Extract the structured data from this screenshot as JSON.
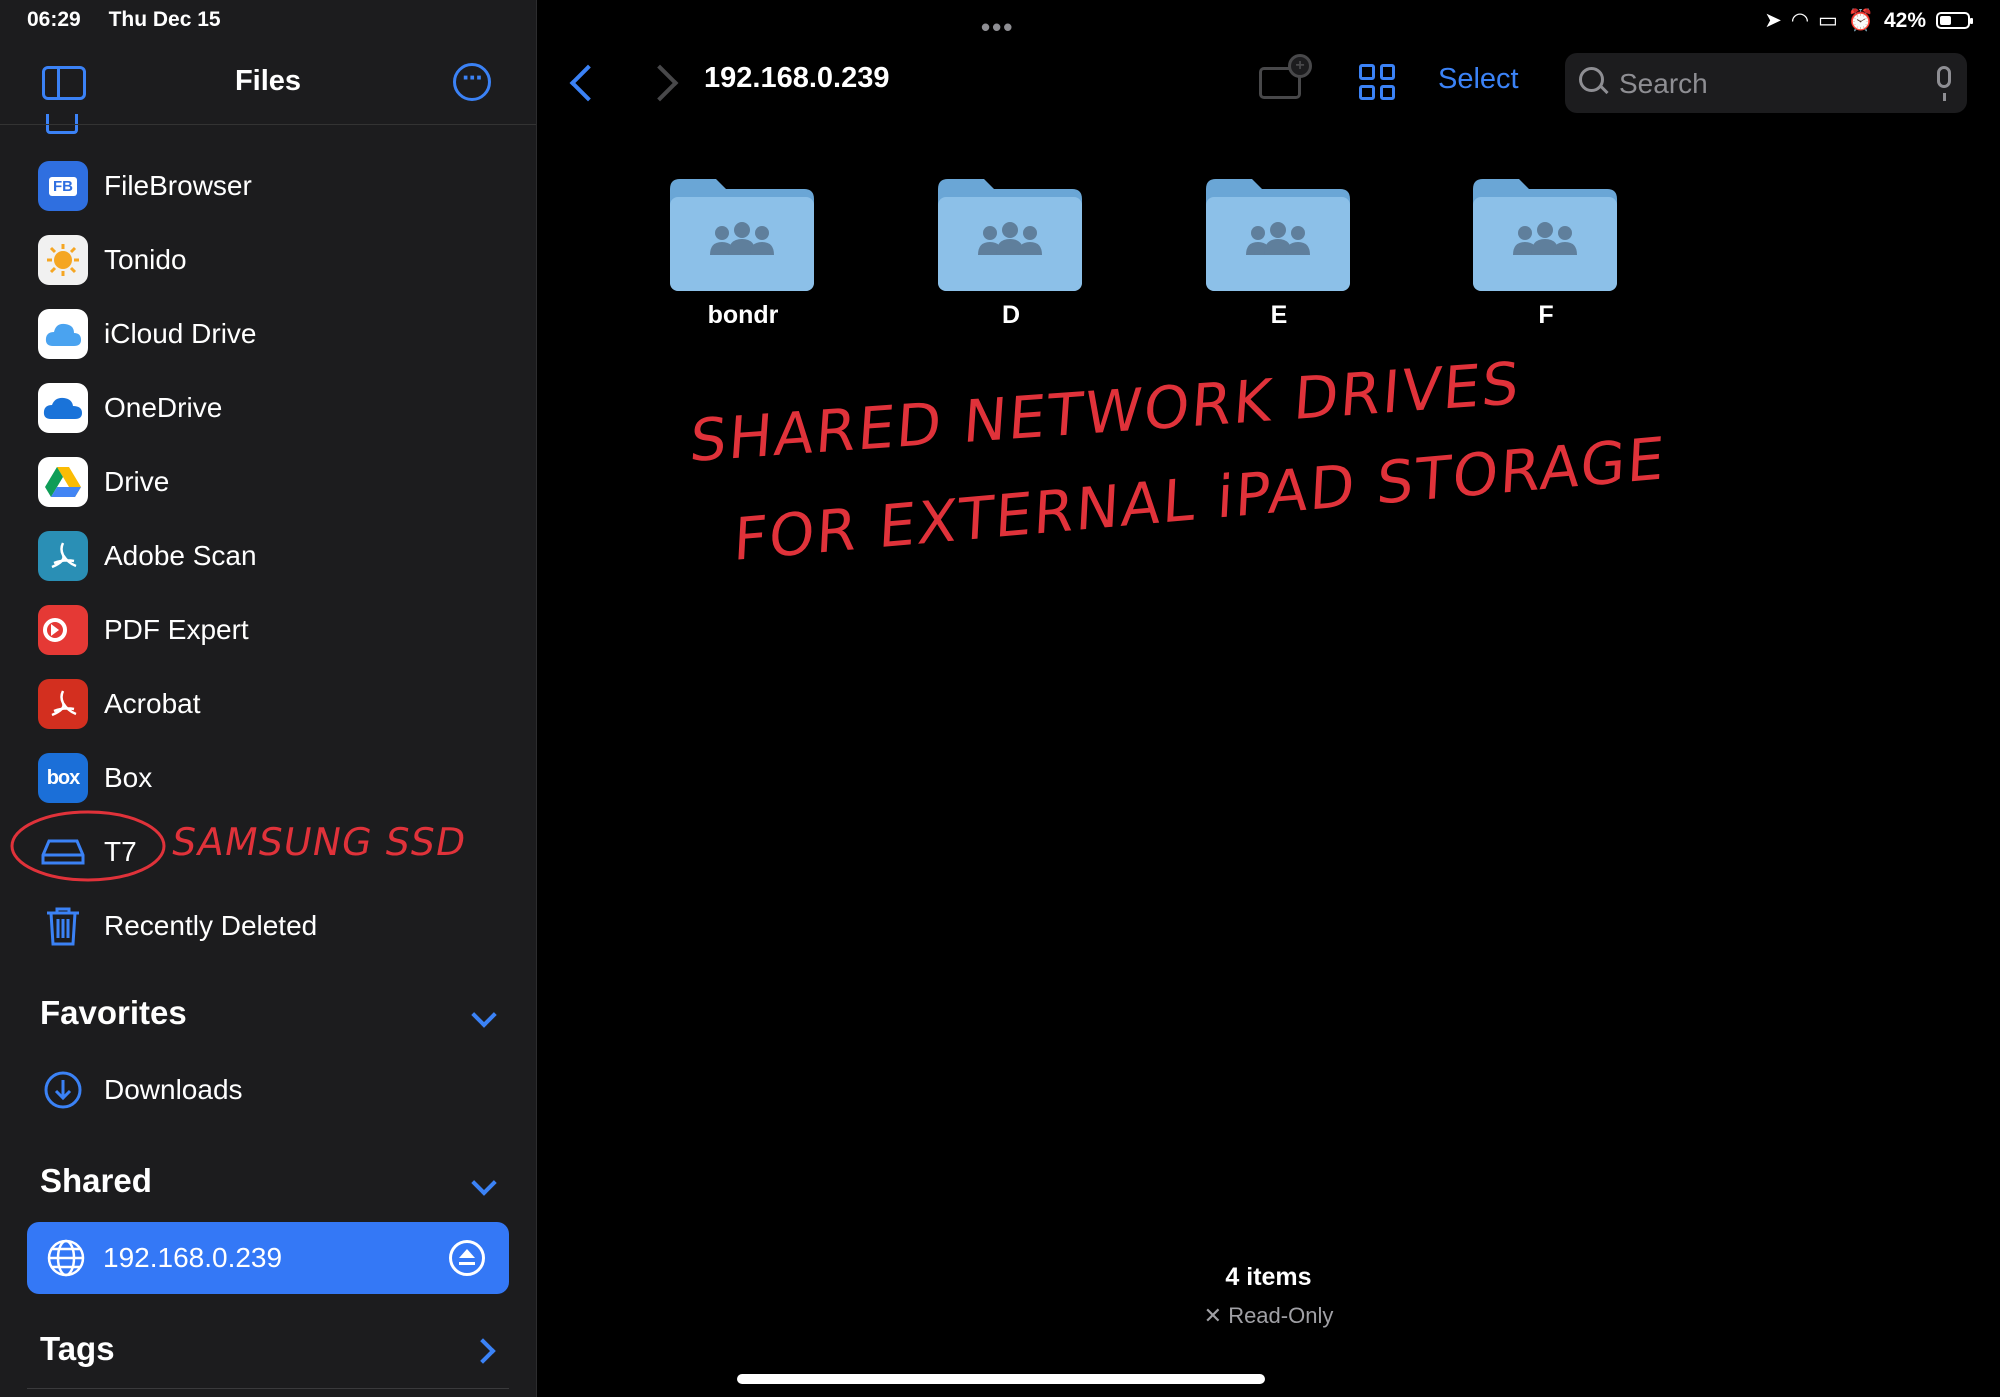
{
  "status": {
    "time": "06:29",
    "date": "Thu Dec 15",
    "battery": "42%"
  },
  "sidebar": {
    "title": "Files",
    "locations": [
      {
        "label": "FileBrowser",
        "icon": "filebrowser-icon",
        "icon_text": "FB",
        "color": "#2f6fe0"
      },
      {
        "label": "Tonido",
        "icon": "tonido-icon",
        "icon_text": "",
        "color": "#f1f1f1"
      },
      {
        "label": "iCloud Drive",
        "icon": "icloud-icon",
        "icon_text": "",
        "color": "#ffffff"
      },
      {
        "label": "OneDrive",
        "icon": "onedrive-icon",
        "icon_text": "",
        "color": "#ffffff"
      },
      {
        "label": "Drive",
        "icon": "google-drive-icon",
        "icon_text": "",
        "color": "#ffffff"
      },
      {
        "label": "Adobe Scan",
        "icon": "adobe-scan-icon",
        "icon_text": "",
        "color": "#2a8fb5"
      },
      {
        "label": "PDF Expert",
        "icon": "pdf-expert-icon",
        "icon_text": "",
        "color": "#e53935"
      },
      {
        "label": "Acrobat",
        "icon": "acrobat-icon",
        "icon_text": "",
        "color": "#d32f1f"
      },
      {
        "label": "Box",
        "icon": "box-icon",
        "icon_text": "box",
        "color": "#1b6fd8"
      },
      {
        "label": "T7",
        "icon": "external-drive-icon",
        "icon_text": "",
        "color": "#3b82f6"
      },
      {
        "label": "Recently Deleted",
        "icon": "trash-icon",
        "icon_text": "",
        "color": "#3b82f6"
      }
    ],
    "annotation_t7": "SAMSUNG SSD",
    "favorites": {
      "header": "Favorites",
      "items": [
        {
          "label": "Downloads",
          "icon": "download-icon"
        }
      ]
    },
    "shared": {
      "header": "Shared",
      "items": [
        {
          "label": "192.168.0.239",
          "icon": "globe-icon"
        }
      ]
    },
    "tags": {
      "header": "Tags"
    }
  },
  "main": {
    "path_title": "192.168.0.239",
    "select_label": "Select",
    "search_placeholder": "Search",
    "folders": [
      {
        "name": "bondr"
      },
      {
        "name": "D"
      },
      {
        "name": "E"
      },
      {
        "name": "F"
      }
    ],
    "annotation": {
      "line1": "SHARED NETWORK DRIVES",
      "line2": "FOR EXTERNAL iPAD STORAGE"
    },
    "footer": {
      "count": "4 items",
      "mode": "Read-Only"
    }
  },
  "colors": {
    "accent": "#3b82f6",
    "sidebar_bg": "#1c1c1e",
    "selection": "#3478f6",
    "annotation": "#e0323a",
    "folder": "#8cc0e8"
  }
}
